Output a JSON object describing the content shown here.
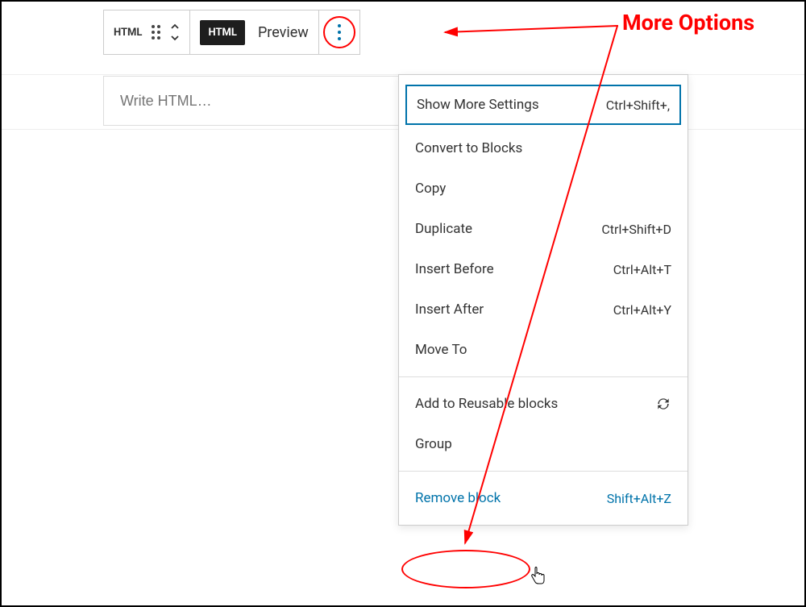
{
  "toolbar": {
    "html_badge": "HTML",
    "html_button": "HTML",
    "preview_label": "Preview"
  },
  "editor": {
    "placeholder": "Write HTML…"
  },
  "menu": {
    "section1": {
      "show_more": {
        "label": "Show More Settings",
        "shortcut": "Ctrl+Shift+,"
      },
      "convert": {
        "label": "Convert to Blocks"
      },
      "copy": {
        "label": "Copy"
      },
      "duplicate": {
        "label": "Duplicate",
        "shortcut": "Ctrl+Shift+D"
      },
      "insert_before": {
        "label": "Insert Before",
        "shortcut": "Ctrl+Alt+T"
      },
      "insert_after": {
        "label": "Insert After",
        "shortcut": "Ctrl+Alt+Y"
      },
      "move_to": {
        "label": "Move To"
      }
    },
    "section2": {
      "reusable": {
        "label": "Add to Reusable blocks"
      },
      "group": {
        "label": "Group"
      }
    },
    "section3": {
      "remove": {
        "label": "Remove block",
        "shortcut": "Shift+Alt+Z"
      }
    }
  },
  "annotation": {
    "label": "More Options"
  }
}
